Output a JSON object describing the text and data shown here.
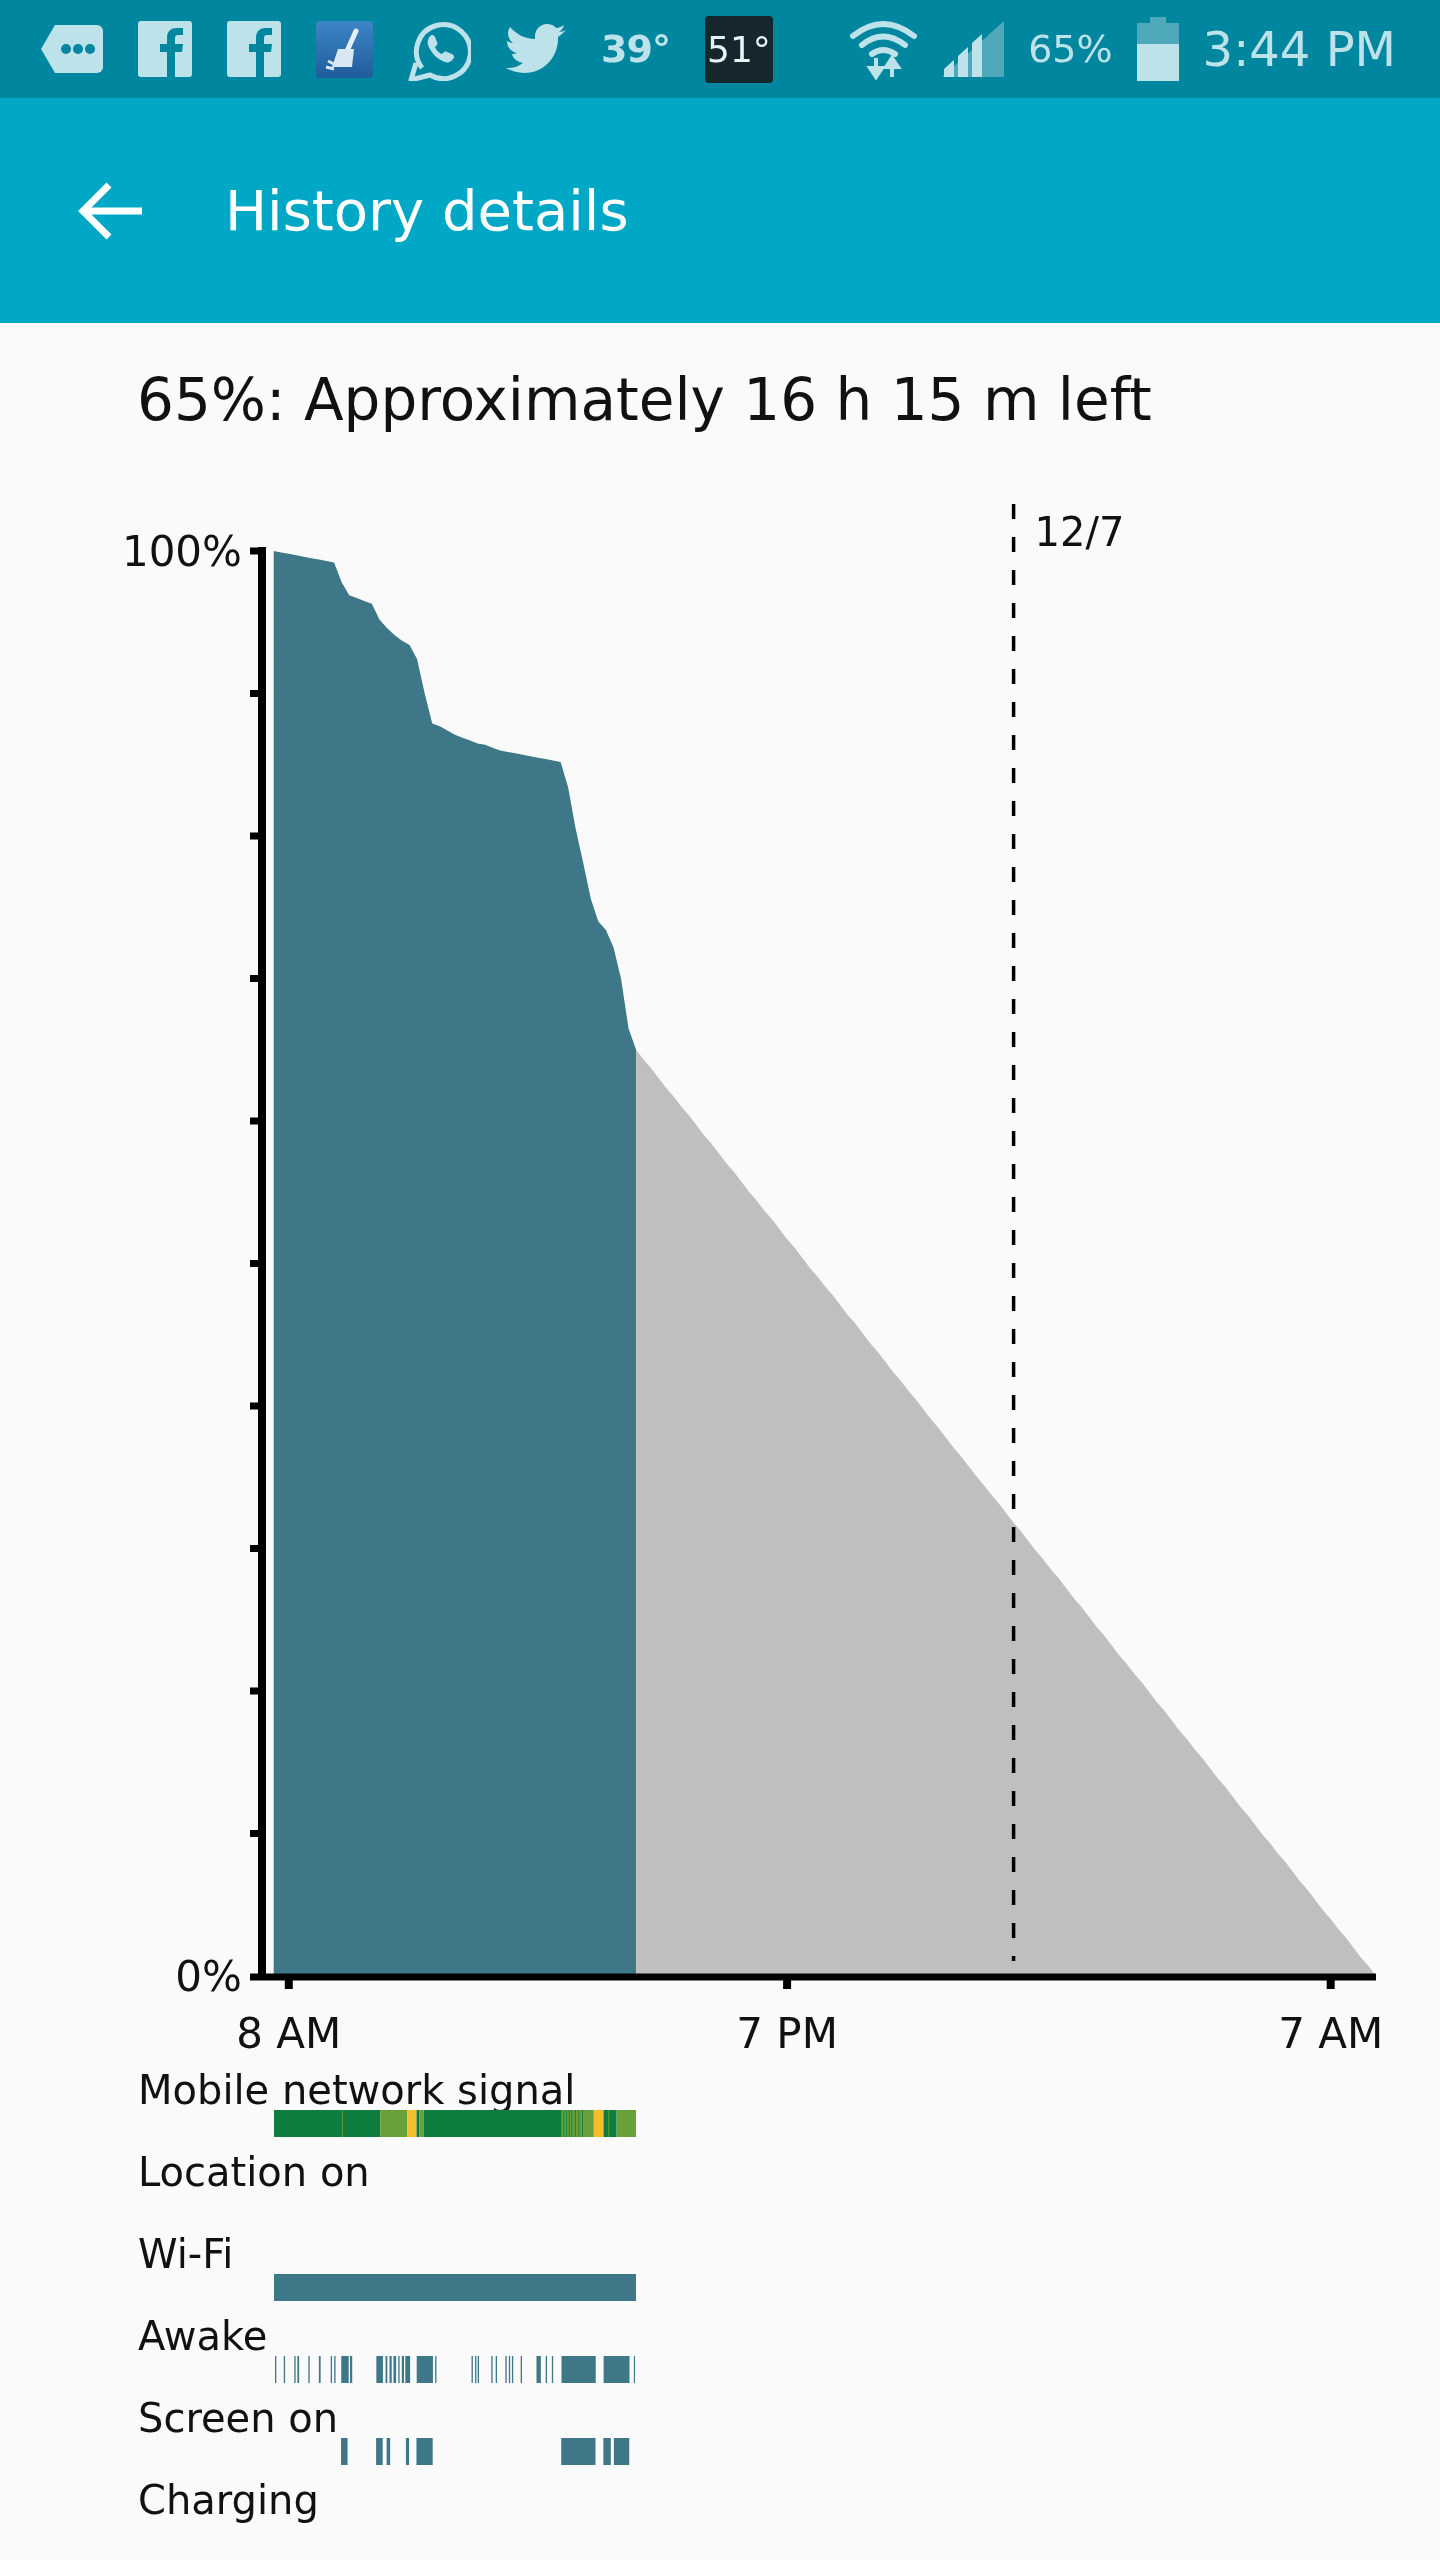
{
  "status_bar": {
    "temperature": "39°",
    "weather_tile": "51°",
    "battery_percent": "65%",
    "time": "3:44 PM"
  },
  "app_bar": {
    "title": "History details"
  },
  "summary": "65%: Approximately 16 h 15 m left",
  "chart": {
    "chart_data": {
      "type": "area",
      "categories": [
        null,
        null,
        "8 AM",
        null,
        null,
        null,
        null,
        null,
        null,
        null,
        null,
        null,
        null,
        null,
        null,
        null,
        null,
        null,
        null,
        null,
        null,
        null,
        null,
        null,
        null,
        null,
        null,
        null,
        null,
        null,
        null,
        null,
        null,
        null,
        null,
        null,
        null,
        null,
        null,
        null,
        null,
        null,
        null,
        null,
        null,
        null,
        null,
        null,
        null,
        null,
        null,
        null,
        null,
        null,
        null,
        null,
        null,
        null,
        null,
        null,
        null,
        null,
        null,
        null,
        null,
        null,
        null,
        null,
        "7 PM",
        null,
        null,
        null,
        null,
        null,
        null,
        null,
        null,
        null,
        null,
        null,
        null,
        null,
        null,
        null,
        null,
        null,
        null,
        null,
        null,
        null,
        null,
        null,
        null,
        null,
        null,
        null,
        null,
        null,
        null,
        null,
        null,
        null,
        null,
        null,
        null,
        null,
        null,
        null,
        null,
        null,
        null,
        null,
        null,
        null,
        null,
        null,
        null,
        null,
        null,
        null,
        null,
        null,
        null,
        null,
        null,
        null,
        null,
        null,
        null,
        null,
        null,
        null,
        null,
        null,
        null,
        null,
        null,
        null,
        null,
        null,
        "7 AM",
        null,
        null,
        null,
        null,
        null,
        null
      ],
      "series": [
        {
          "color": "#3e7888",
          "values": [
            100,
            99.9,
            99.8,
            99.7,
            99.6,
            99.5,
            99.4,
            99.3,
            99.2,
            97.8,
            96.9,
            96.7,
            96.5,
            96.3,
            95.2,
            94.6,
            94.1,
            93.7,
            93.4,
            92.4,
            90,
            87.9,
            87.7,
            87.4,
            87.1,
            86.9,
            86.7,
            86.5,
            86.4,
            86.2,
            86,
            85.9,
            85.8,
            85.7,
            85.6,
            85.5,
            85.4,
            85.3,
            85.2,
            83.4,
            80.5,
            78.1,
            75.6,
            74,
            73.4,
            72.2,
            70,
            66.5,
            65,
            null,
            null,
            null,
            null,
            null,
            null,
            null,
            null,
            null,
            null,
            null,
            null,
            null,
            null,
            null,
            null,
            null,
            null,
            null,
            null,
            null,
            null,
            null,
            null,
            null,
            null,
            null,
            null,
            null,
            null,
            null,
            null,
            null,
            null,
            null,
            null,
            null,
            null,
            null,
            null,
            null,
            null,
            null,
            null,
            null,
            null,
            null,
            null,
            null,
            null,
            null,
            null,
            null,
            null,
            null,
            null,
            null,
            null,
            null,
            null,
            null,
            null,
            null,
            null,
            null,
            null,
            null,
            null,
            null,
            null,
            null,
            null,
            null,
            null,
            null,
            null,
            null,
            null,
            null,
            null,
            null,
            null,
            null,
            null,
            null,
            null,
            null,
            null,
            null,
            null,
            null,
            null,
            null,
            null,
            null,
            null,
            null,
            null
          ]
        },
        {
          "color": "#bfbfbf",
          "values": [
            null,
            null,
            null,
            null,
            null,
            null,
            null,
            null,
            null,
            null,
            null,
            null,
            null,
            null,
            null,
            null,
            null,
            null,
            null,
            null,
            null,
            null,
            null,
            null,
            null,
            null,
            null,
            null,
            null,
            null,
            null,
            null,
            null,
            null,
            null,
            null,
            null,
            null,
            null,
            null,
            null,
            null,
            null,
            null,
            null,
            null,
            null,
            null,
            65,
            64.3,
            63.7,
            63,
            62.3,
            61.7,
            61,
            60.4,
            59.7,
            59,
            58.4,
            57.7,
            57,
            56.4,
            55.7,
            55,
            54.4,
            53.7,
            53.1,
            52.4,
            51.7,
            51.1,
            50.4,
            49.7,
            49.1,
            48.4,
            47.8,
            47.1,
            46.4,
            45.8,
            45.1,
            44.4,
            43.8,
            43.1,
            42.4,
            41.8,
            41.1,
            40.5,
            39.8,
            39.1,
            38.5,
            37.8,
            37.1,
            36.5,
            35.8,
            35.1,
            34.5,
            33.8,
            33.2,
            32.5,
            31.8,
            31.2,
            30.5,
            29.8,
            29.2,
            28.5,
            27.9,
            27.2,
            26.5,
            25.9,
            25.2,
            24.5,
            23.9,
            23.2,
            22.5,
            21.9,
            21.2,
            20.6,
            19.9,
            19.2,
            18.6,
            17.9,
            17.2,
            16.6,
            15.9,
            15.3,
            14.6,
            13.9,
            13.3,
            12.6,
            11.9,
            11.3,
            10.6,
            9.9,
            9.3,
            8.6,
            8,
            7.3,
            6.6,
            6,
            5.3,
            4.6,
            4,
            3.3,
            2.7,
            2,
            1.3,
            0.7,
            0
          ]
        }
      ],
      "ylim": [
        0,
        100
      ],
      "yticks": [
        {
          "value": 0,
          "label": "0%"
        },
        {
          "value": 100,
          "label": "100%"
        }
      ],
      "annotations": [
        "12/7"
      ]
    }
  },
  "activity_rows": [
    {
      "label": "Mobile network signal",
      "kind": "signal"
    },
    {
      "label": "Location on",
      "kind": "none"
    },
    {
      "label": "Wi-Fi",
      "kind": "solid"
    },
    {
      "label": "Awake",
      "kind": "awake"
    },
    {
      "label": "Screen on",
      "kind": "screen"
    },
    {
      "label": "Charging",
      "kind": "none"
    }
  ]
}
